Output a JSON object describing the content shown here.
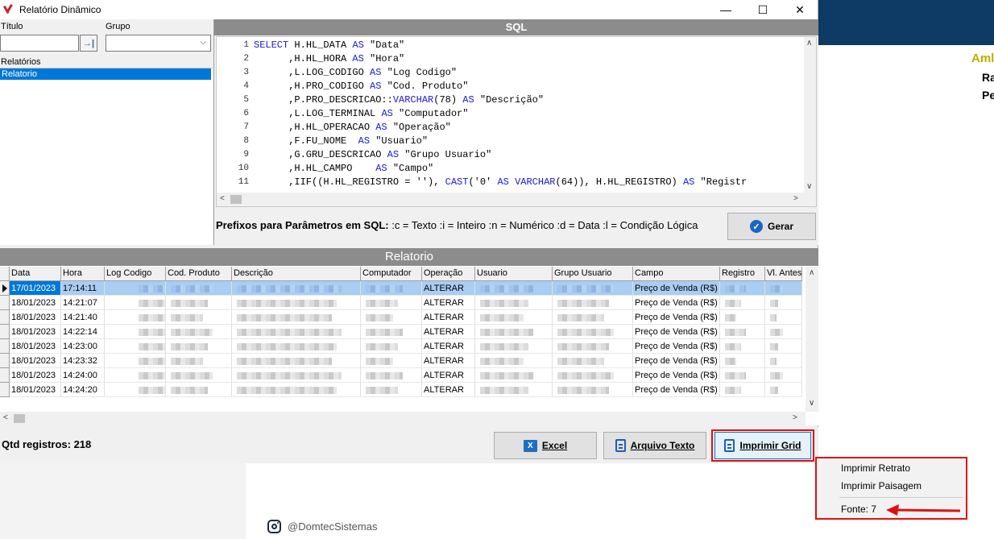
{
  "window": {
    "title": "Relatório Dinâmico",
    "minimize": "—",
    "maximize": "☐",
    "close": "✕"
  },
  "filters": {
    "titulo_label": "Título",
    "titulo_value": "",
    "titulo_btn": "→|",
    "grupo_label": "Grupo",
    "grupo_value": "",
    "relatorios_label": "Relatórios",
    "relatorios_items": [
      "Relatorio"
    ]
  },
  "sql": {
    "header": "SQL",
    "lines": [
      {
        "n": "1",
        "kw": "SELECT",
        "rest": " H.HL_DATA ",
        "kw2": "AS",
        "tail": " \"Data\""
      },
      {
        "n": "2",
        "kw": "",
        "rest": "      ,H.HL_HORA ",
        "kw2": "AS",
        "tail": " \"Hora\""
      },
      {
        "n": "3",
        "kw": "",
        "rest": "      ,L.LOG_CODIGO ",
        "kw2": "AS",
        "tail": " \"Log Codigo\""
      },
      {
        "n": "4",
        "kw": "",
        "rest": "      ,H.PRO_CODIGO ",
        "kw2": "AS",
        "tail": " \"Cod. Produto\""
      },
      {
        "n": "5",
        "kw": "",
        "rest": "      ,P.PRO_DESCRICAO::",
        "kw2": "VARCHAR",
        "tail": "(78) ",
        "kw3": "AS",
        "tail2": " \"Descrição\""
      },
      {
        "n": "6",
        "kw": "",
        "rest": "      ,L.LOG_TERMINAL ",
        "kw2": "AS",
        "tail": " \"Computador\""
      },
      {
        "n": "7",
        "kw": "",
        "rest": "      ,H.HL_OPERACAO ",
        "kw2": "AS",
        "tail": " \"Operação\""
      },
      {
        "n": "8",
        "kw": "",
        "rest": "      ,F.FU_NOME  ",
        "kw2": "AS",
        "tail": " \"Usuario\""
      },
      {
        "n": "9",
        "kw": "",
        "rest": "      ,G.GRU_DESCRICAO ",
        "kw2": "AS",
        "tail": " \"Grupo Usuario\""
      },
      {
        "n": "10",
        "kw": "",
        "rest": "      ,H.HL_CAMPO    ",
        "kw2": "AS",
        "tail": " \"Campo\""
      },
      {
        "n": "11",
        "kw": "",
        "rest": "      ,IIF((H.HL_REGISTRO = ''), ",
        "kw2": "CAST",
        "tail": "('0' ",
        "kw3": "AS",
        "tail2": " ",
        "kw4": "VARCHAR",
        "tail3": "(64)), H.HL_REGISTRO) ",
        "kw5": "AS",
        "tail4": " \"Registr"
      }
    ],
    "prefix_bold": "Prefixos para Parâmetros em SQL:",
    "prefix_rest": " :c = Texto  :i = Inteiro  :n = Numérico  :d = Data  :l = Condição Lógica",
    "gerar": "Gerar"
  },
  "grid": {
    "header": "Relatorio",
    "columns": [
      "Data",
      "Hora",
      "Log Codigo",
      "Cod. Produto",
      "Descrição",
      "Computador",
      "Operação",
      "Usuario",
      "Grupo Usuario",
      "Campo",
      "Registro",
      "Vl. Antes"
    ],
    "rows": [
      {
        "data": "17/01/2023",
        "hora": "17:14:11",
        "operacao": "ALTERAR",
        "campo": "Preço de Venda (R$)"
      },
      {
        "data": "18/01/2023",
        "hora": "14:21:07",
        "operacao": "ALTERAR",
        "campo": "Preço de Venda (R$)"
      },
      {
        "data": "18/01/2023",
        "hora": "14:21:40",
        "operacao": "ALTERAR",
        "campo": "Preço de Venda (R$)"
      },
      {
        "data": "18/01/2023",
        "hora": "14:22:14",
        "operacao": "ALTERAR",
        "campo": "Preço de Venda (R$)"
      },
      {
        "data": "18/01/2023",
        "hora": "14:23:00",
        "operacao": "ALTERAR",
        "campo": "Preço de Venda (R$)"
      },
      {
        "data": "18/01/2023",
        "hora": "14:23:32",
        "operacao": "ALTERAR",
        "campo": "Preço de Venda (R$)"
      },
      {
        "data": "18/01/2023",
        "hora": "14:24:00",
        "operacao": "ALTERAR",
        "campo": "Preço de Venda (R$)"
      },
      {
        "data": "18/01/2023",
        "hora": "14:24:20",
        "operacao": "ALTERAR",
        "campo": "Preço de Venda (R$)"
      }
    ]
  },
  "footer": {
    "qtd": "Qtd registros: 218",
    "excel": "Excel",
    "arquivo": "Arquivo Texto",
    "imprimir": "Imprimir Grid"
  },
  "popup": {
    "retrato": "Imprimir Retrato",
    "paisagem": "Imprimir Paisagem",
    "fonte": "Fonte: 7"
  },
  "background": {
    "amb": "Aml",
    "ra": "Ra",
    "pe": "Pe",
    "social": "@DomtecSistemas"
  },
  "colors": {
    "accent": "#0078d7",
    "header_gray": "#8c8c8c",
    "highlight_red": "#e01010",
    "keyword_blue": "#1a1ad8"
  }
}
